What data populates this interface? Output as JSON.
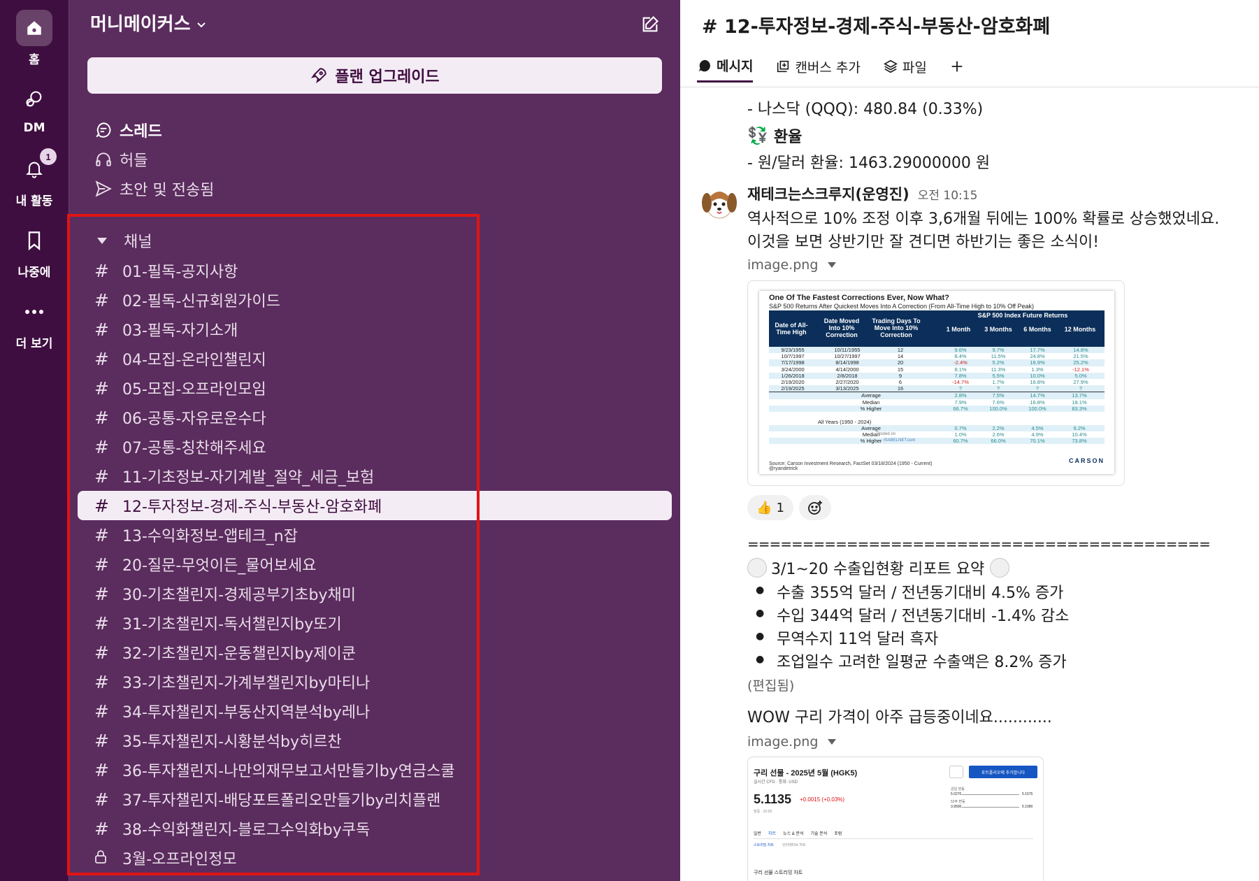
{
  "rail": {
    "home_label": "홈",
    "dm_label": "DM",
    "activity_label": "내 활동",
    "activity_badge": "1",
    "later_label": "나중에",
    "more_label": "더 보기"
  },
  "sidebar": {
    "workspace_name": "머니메이커스",
    "upgrade_label": "플랜 업그레이드",
    "threads_label": "스레드",
    "huddles_label": "허들",
    "drafts_label": "초안 및 전송됨",
    "channels_header": "채널",
    "channels": [
      {
        "name": "01-필독-공지사항",
        "icon": "hash"
      },
      {
        "name": "02-필독-신규회원가이드",
        "icon": "hash"
      },
      {
        "name": "03-필독-자기소개",
        "icon": "hash"
      },
      {
        "name": "04-모집-온라인챌린지",
        "icon": "hash"
      },
      {
        "name": "05-모집-오프라인모임",
        "icon": "hash"
      },
      {
        "name": "06-공통-자유로운수다",
        "icon": "hash"
      },
      {
        "name": "07-공통-칭찬해주세요",
        "icon": "hash"
      },
      {
        "name": "11-기초정보-자기계발_절약_세금_보험",
        "icon": "hash"
      },
      {
        "name": "12-투자정보-경제-주식-부동산-암호화폐",
        "icon": "hash",
        "active": true
      },
      {
        "name": "13-수익화정보-앱테크_n잡",
        "icon": "hash"
      },
      {
        "name": "20-질문-무엇이든_물어보세요",
        "icon": "hash"
      },
      {
        "name": "30-기초챌린지-경제공부기초by채미",
        "icon": "hash"
      },
      {
        "name": "31-기초챌린지-독서챌린지by또기",
        "icon": "hash"
      },
      {
        "name": "32-기초챌린지-운동챌린지by제이쿤",
        "icon": "hash"
      },
      {
        "name": "33-기초챌린지-가계부챌린지by마티나",
        "icon": "hash"
      },
      {
        "name": "34-투자챌린지-부동산지역분석by레나",
        "icon": "hash"
      },
      {
        "name": "35-투자챌린지-시황분석by히르찬",
        "icon": "hash"
      },
      {
        "name": "36-투자챌린지-나만의재무보고서만들기by연금스쿨",
        "icon": "hash"
      },
      {
        "name": "37-투자챌린지-배당포트폴리오만들기by리치플랜",
        "icon": "hash"
      },
      {
        "name": "38-수익화챌린지-블로그수익화by쿠독",
        "icon": "hash"
      },
      {
        "name": "3월-오프라인정모",
        "icon": "lock"
      }
    ]
  },
  "main": {
    "channel_title": "# 12-투자정보-경제-주식-부동산-암호화폐",
    "tabs": {
      "messages": "메시지",
      "canvas": "캔버스 추가",
      "files": "파일"
    },
    "msg_nasdaq": "- 나스닥 (QQQ): 480.84 (0.33%)",
    "fx_emoji": "💱",
    "fx_header": "환율",
    "fx_line": "- 원/달러 환율: 1463.29000000 원",
    "author_name": "재테크는스크루지(운영진)",
    "author_time": "오전 10:15",
    "msg_line1": "역사적으로 10% 조정 이후 3,6개월 뒤에는 100% 확률로 상승했었네요.",
    "msg_line2": "이것을 보면 상반기만 잘 견디면 하반기는 좋은 소식이!",
    "file1_name": "image.png",
    "reaction_thumb": "👍",
    "reaction_count": "1",
    "separator": "==========================================",
    "report_title": "3/1~20 수출입현황 리포트 요약",
    "report_bullets": [
      "수출 355억 달러 / 전년동기대비 4.5% 증가",
      "수입 344억 달러 / 전년동기대비 -1.4% 감소",
      "무역수지 11억 달러 흑자",
      "조업일수 고려한 일평균 수출액은 8.2% 증가"
    ],
    "edited": "(편집됨)",
    "copper_msg": "WOW 구리 가격이 아주 급등중이네요............",
    "file2_name": "image.png"
  },
  "table_image": {
    "title": "One Of The Fastest Corrections Ever, Now What?",
    "subtitle": "S&P 500 Returns After Quickest Moves Into A Correction (From All-Time High to 10% Off Peak)",
    "group_header": "S&P 500 Index Future Returns",
    "headers": [
      "Date of All-Time High",
      "Date Moved Into 10% Correction",
      "Trading Days To Move Into 10% Correction",
      "1 Month",
      "3 Months",
      "6 Months",
      "12 Months"
    ],
    "rows": [
      [
        "9/23/1955",
        "10/11/1955",
        "12",
        "9.6%",
        "9.7%",
        "17.7%",
        "14.8%"
      ],
      [
        "10/7/1997",
        "10/27/1997",
        "14",
        "8.4%",
        "11.5%",
        "24.8%",
        "21.5%"
      ],
      [
        "7/17/1998",
        "8/14/1998",
        "20",
        "-2.4%",
        "5.2%",
        "16.9%",
        "25.2%"
      ],
      [
        "3/24/2000",
        "4/14/2000",
        "15",
        "8.1%",
        "11.3%",
        "1.3%",
        "-12.1%"
      ],
      [
        "1/26/2018",
        "2/8/2018",
        "9",
        "7.8%",
        "5.5%",
        "10.0%",
        "5.0%"
      ],
      [
        "2/19/2020",
        "2/27/2020",
        "6",
        "-14.7%",
        "1.7%",
        "16.8%",
        "27.9%"
      ],
      [
        "2/19/2025",
        "3/13/2025",
        "16",
        "?",
        "?",
        "?",
        "?"
      ]
    ],
    "avg_rows": [
      [
        "Average",
        "2.8%",
        "7.5%",
        "14.7%",
        "13.7%"
      ],
      [
        "Median",
        "7.9%",
        "7.6%",
        "16.8%",
        "18.1%"
      ],
      [
        "% Higher",
        "66.7%",
        "100.0%",
        "100.0%",
        "83.3%"
      ]
    ],
    "all_years_label": "All Years (1950 - 2024)",
    "all_years_rows": [
      [
        "Average",
        "0.7%",
        "2.2%",
        "4.5%",
        "9.2%"
      ],
      [
        "Median",
        "1.0%",
        "2.6%",
        "4.9%",
        "10.4%"
      ],
      [
        "% Higher",
        "60.7%",
        "66.0%",
        "70.1%",
        "73.8%"
      ]
    ],
    "posted_on": "Posted on",
    "isabelnet": "ISABELNET.com",
    "source": "Source: Carson Investment Research, FactSet 03/18/2024 (1950 - Current)",
    "handle": "@ryandetrick",
    "brand": "CARSON"
  },
  "copper_image": {
    "title": "구리 선물 - 2025년 5월 (HGK5)",
    "meta1": "실시간 CFD",
    "meta2": "통화: USD",
    "price": "5.1135",
    "change": "+0.0015 (+0.03%)",
    "time_label": "장중 · 22:03",
    "add_portfolio": "포트폴리오에 추가합니다",
    "day_range_label": "금일 변동",
    "day_low": "5.0270",
    "day_high": "5.1575",
    "wk52_label": "52주 변동",
    "wk52_low": "3.9500",
    "wk52_high": "5.1990",
    "subtabs": [
      "일반",
      "차트",
      "뉴스 & 분석",
      "기술 분석",
      "포럼"
    ],
    "subtabs2": [
      "스트리밍 차트",
      "인터랙티브 차트"
    ],
    "stream_title": "구리 선물 스트리밍 차트"
  },
  "colors": {
    "rail_bg": "#3f0e40",
    "sidebar_bg": "#5b2c5e",
    "active_bg": "#f4ecf5",
    "highlight_border": "#e01414"
  }
}
